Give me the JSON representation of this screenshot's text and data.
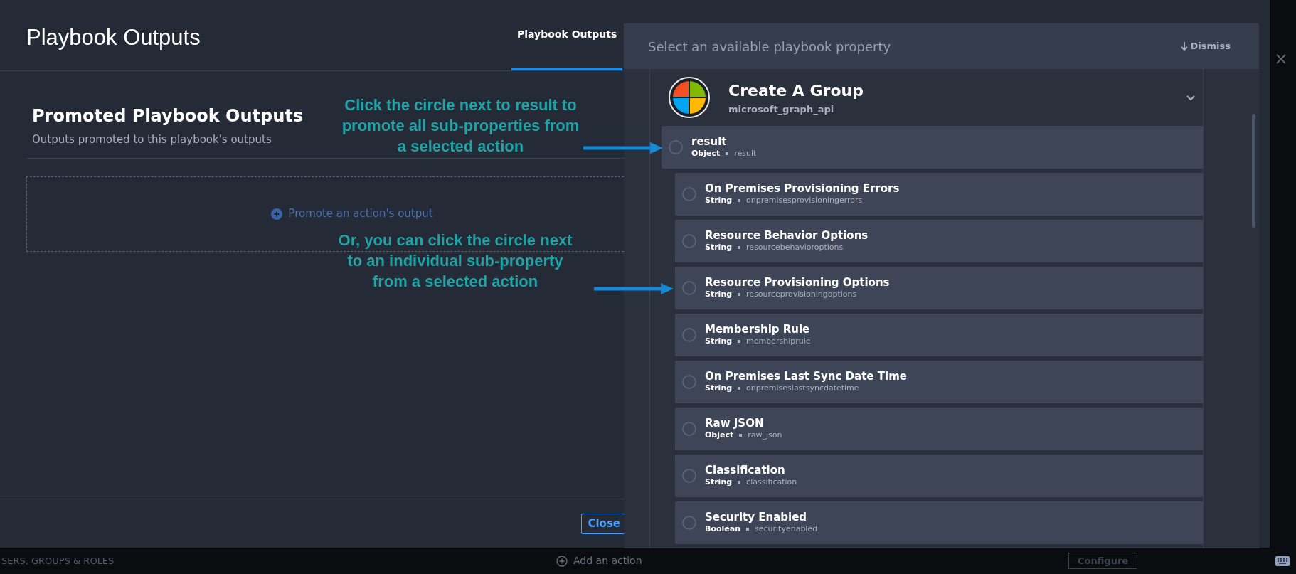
{
  "modal": {
    "title": "Playbook Outputs",
    "tabs": [
      {
        "label": "Playbook Outputs",
        "selected": true
      }
    ],
    "section_title": "Promoted Playbook Outputs",
    "section_subtitle": "Outputs promoted to this playbook's outputs",
    "promote_link": "Promote an action's output",
    "close_button": "Close"
  },
  "property_panel": {
    "prompt": "Select an available playbook property",
    "dismiss": "Dismiss",
    "action": {
      "title": "Create A Group",
      "integration": "microsoft_graph_api",
      "expanded": true
    },
    "properties": [
      {
        "name": "result",
        "type": "Object",
        "key": "result",
        "selected": false,
        "children": [
          {
            "name": "On Premises Provisioning Errors",
            "type": "String",
            "key": "onpremisesprovisioningerrors",
            "selected": false
          },
          {
            "name": "Resource Behavior Options",
            "type": "String",
            "key": "resourcebehavioroptions",
            "selected": false
          },
          {
            "name": "Resource Provisioning Options",
            "type": "String",
            "key": "resourceprovisioningoptions",
            "selected": false
          },
          {
            "name": "Membership Rule",
            "type": "String",
            "key": "membershiprule",
            "selected": false
          },
          {
            "name": "On Premises Last Sync Date Time",
            "type": "String",
            "key": "onpremiseslastsyncdatetime",
            "selected": false
          },
          {
            "name": "Raw JSON",
            "type": "Object",
            "key": "raw_json",
            "selected": false
          },
          {
            "name": "Classification",
            "type": "String",
            "key": "classification",
            "selected": false
          },
          {
            "name": "Security Enabled",
            "type": "Boolean",
            "key": "securityenabled",
            "selected": false
          }
        ]
      }
    ]
  },
  "annotations": [
    "Click the circle next to result to promote all sub-properties from a selected action",
    "Or, you can click the circle next to an individual sub-property from a selected action"
  ],
  "background": {
    "sidebar_item": "SERS, GROUPS & ROLES",
    "add_action": "Add an action",
    "configure_button": "Configure"
  }
}
